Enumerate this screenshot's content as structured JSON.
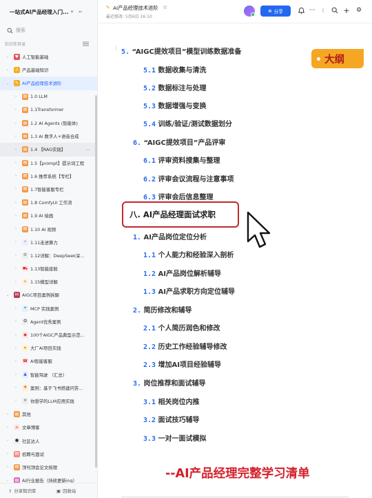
{
  "sidebar": {
    "kb_name": "一站式AI产品经理入门...",
    "search_placeholder": "搜索",
    "section_label": "知识库目录",
    "items": [
      {
        "label": "人工智能基础"
      },
      {
        "label": "产品基础知识"
      },
      {
        "label": "AI产品经理技术进阶"
      },
      {
        "label": "1.0 LLM"
      },
      {
        "label": "1.1Transformer"
      },
      {
        "label": "1.2 AI Agents (智能体)"
      },
      {
        "label": "1.3 AI 数字人+语音合成"
      },
      {
        "label": "1.4 【RAG实践】"
      },
      {
        "label": "1.5【prompt】提示词工程"
      },
      {
        "label": "1.6 推荐系统【专栏】"
      },
      {
        "label": "1.7智能客服专栏"
      },
      {
        "label": "1.8 ComfyUI 工作流"
      },
      {
        "label": "1.9 AI 绘画"
      },
      {
        "label": "1.10 AI 视频"
      },
      {
        "label": "1.11走进算力"
      },
      {
        "label": "1.12详解：DeepSeek深..."
      },
      {
        "label": "1.13智能座舱"
      },
      {
        "label": "1.15模型详解"
      },
      {
        "label": "AIGC项目案例拆解"
      },
      {
        "label": "MCP 实践案例"
      },
      {
        "label": "Agent优秀案例"
      },
      {
        "label": "100个AIGC产品典型示范..."
      },
      {
        "label": "大厂AI项目实践"
      },
      {
        "label": "AI智能客服"
      },
      {
        "label": "智能驾驶 （汇总）"
      },
      {
        "label": "案例：基于飞书搭建问答..."
      },
      {
        "label": "你想学的LLM应用实践"
      },
      {
        "label": "其他"
      },
      {
        "label": "文章博客"
      },
      {
        "label": "社区达人"
      },
      {
        "label": "招聘与面试"
      },
      {
        "label": "顶刊顶会论文梳理"
      },
      {
        "label": "AI行业报告（持续更新ing）"
      }
    ],
    "footer": {
      "share_label": "分享知识库",
      "trash_label": "回收站"
    }
  },
  "topbar": {
    "doc_title": "AI产品经理技术进阶",
    "meta": "最近修改: 5月6日 16:10",
    "share_label": "分享"
  },
  "outline": {
    "badge": "大纲",
    "items": [
      {
        "num": "5.",
        "text": "“AIGC提效项目”模型训练数据准备"
      },
      {
        "num": "5.1",
        "text": "数据收集与清洗"
      },
      {
        "num": "5.2",
        "text": "数据标注与处理"
      },
      {
        "num": "5.3",
        "text": "数据增强与变换"
      },
      {
        "num": "5.4",
        "text": "训练/验证/测试数据划分"
      },
      {
        "num": "6.",
        "text": "“AIGC提效项目”产品评审"
      },
      {
        "num": "6.1",
        "text": "评审资料搜集与整理"
      },
      {
        "num": "6.2",
        "text": "评审会议流程与注意事项"
      },
      {
        "num": "6.3",
        "text": "评审会后信息整理"
      },
      {
        "num": "1.",
        "text": "AI产品岗位定位分析"
      },
      {
        "num": "1.1",
        "text": "个人能力和经验深入剖析"
      },
      {
        "num": "1.2",
        "text": "AI产品岗位解析辅导"
      },
      {
        "num": "1.3",
        "text": "AI产品求职方向定位辅导"
      },
      {
        "num": "2.",
        "text": "简历修改和辅导"
      },
      {
        "num": "2.1",
        "text": "个人简历润色和修改"
      },
      {
        "num": "2.2",
        "text": "历史工作经验辅导修改"
      },
      {
        "num": "2.3",
        "text": "增加AI项目经验辅导"
      },
      {
        "num": "3.",
        "text": "岗位推荐和面试辅导"
      },
      {
        "num": "3.1",
        "text": "相关岗位内推"
      },
      {
        "num": "3.2",
        "text": "面试技巧辅导"
      },
      {
        "num": "3.3",
        "text": "一对一面试模拟"
      }
    ],
    "highlight": "八. AI产品经理面试求职",
    "bottom_title": "--AI产品经理完整学习清单"
  }
}
